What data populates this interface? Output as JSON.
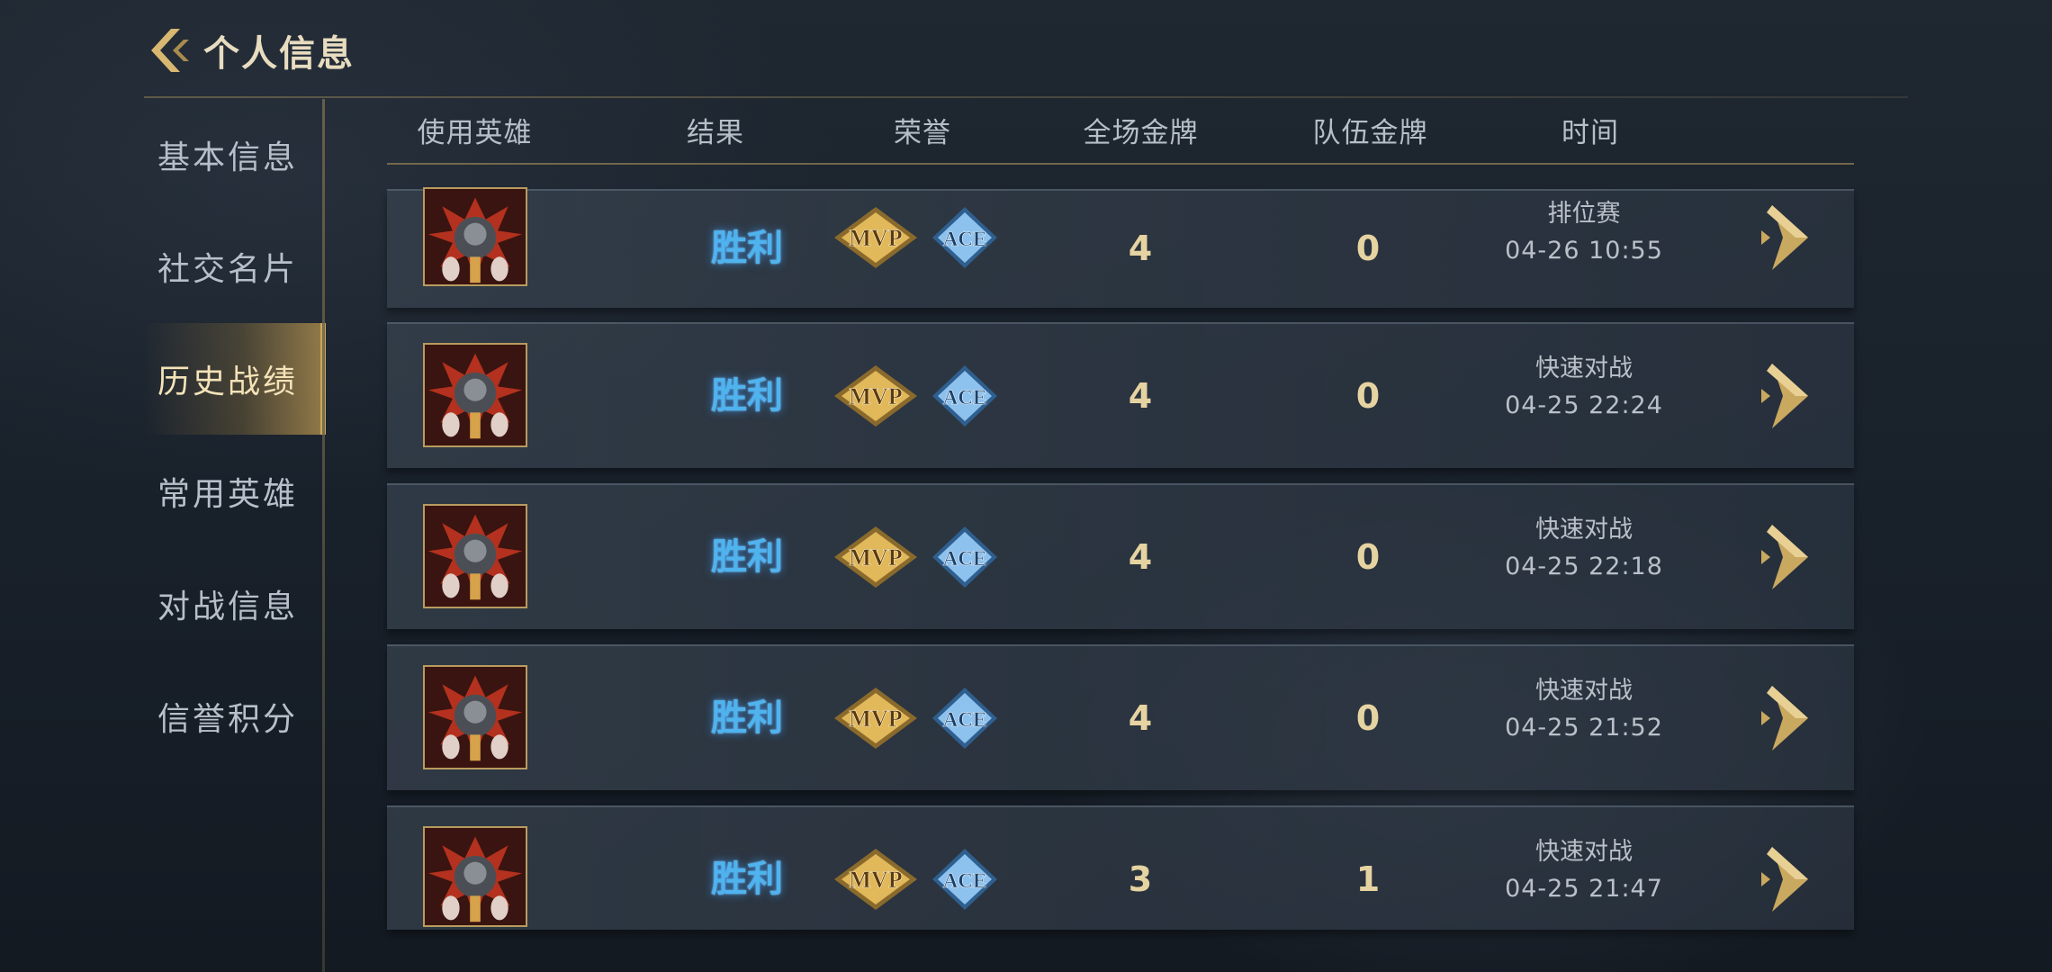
{
  "header": {
    "title": "个人信息"
  },
  "sidebar": {
    "items": [
      {
        "label": "基本信息"
      },
      {
        "label": "社交名片"
      },
      {
        "label": "历史战绩",
        "active": true
      },
      {
        "label": "常用英雄"
      },
      {
        "label": "对战信息"
      },
      {
        "label": "信誉积分"
      }
    ]
  },
  "table": {
    "columns": [
      "使用英雄",
      "结果",
      "荣誉",
      "全场金牌",
      "队伍金牌",
      "时间"
    ],
    "rows": [
      {
        "result": "胜利",
        "honors": [
          "MVP",
          "ACE"
        ],
        "total_gold": "4",
        "team_gold": "0",
        "mode": "排位赛",
        "time": "04-26  10:55"
      },
      {
        "result": "胜利",
        "honors": [
          "MVP",
          "ACE"
        ],
        "total_gold": "4",
        "team_gold": "0",
        "mode": "快速对战",
        "time": "04-25  22:24"
      },
      {
        "result": "胜利",
        "honors": [
          "MVP",
          "ACE"
        ],
        "total_gold": "4",
        "team_gold": "0",
        "mode": "快速对战",
        "time": "04-25  22:18"
      },
      {
        "result": "胜利",
        "honors": [
          "MVP",
          "ACE"
        ],
        "total_gold": "4",
        "team_gold": "0",
        "mode": "快速对战",
        "time": "04-25  21:52"
      },
      {
        "result": "胜利",
        "honors": [
          "MVP",
          "ACE"
        ],
        "total_gold": "3",
        "team_gold": "1",
        "mode": "快速对战",
        "time": "04-25  21:47"
      }
    ]
  },
  "icons": {
    "back": "back-chevron-icon",
    "detail": "detail-chevron-icon",
    "hero": "hero-portrait"
  },
  "colors": {
    "accent_gold": "#c9a85f",
    "victory_blue": "#4fb3ee",
    "number_gold": "#e6d3a2"
  }
}
